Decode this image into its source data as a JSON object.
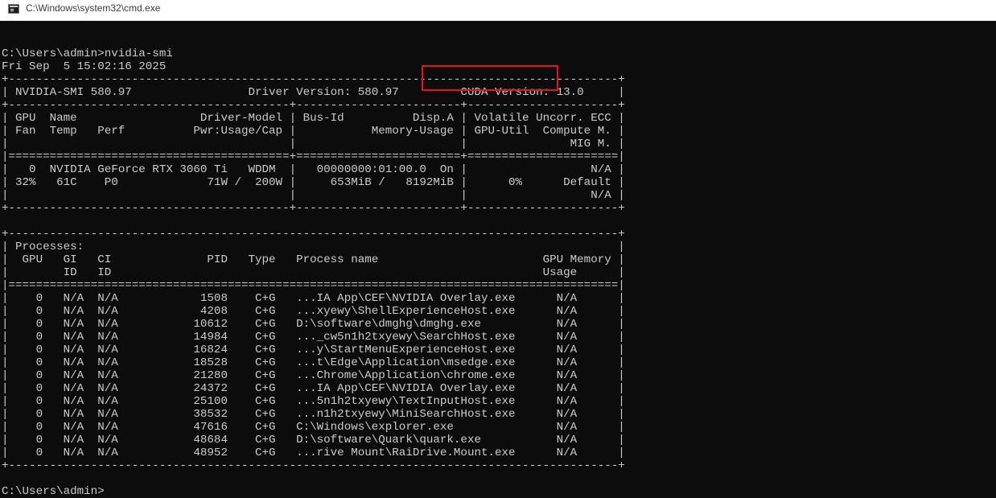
{
  "window": {
    "title": "C:\\Windows\\system32\\cmd.exe",
    "icon": "console-icon"
  },
  "console": {
    "lines": [
      "",
      "C:\\Users\\admin>nvidia-smi",
      "Fri Sep  5 15:02:16 2025",
      "+-----------------------------------------------------------------------------------------+",
      "| NVIDIA-SMI 580.97                 Driver Version: 580.97         CUDA Version: 13.0     |",
      "+-----------------------------------------+------------------------+----------------------+",
      "| GPU  Name                  Driver-Model | Bus-Id          Disp.A | Volatile Uncorr. ECC |",
      "| Fan  Temp   Perf          Pwr:Usage/Cap |           Memory-Usage | GPU-Util  Compute M. |",
      "|                                         |                        |               MIG M. |",
      "|=========================================+========================+======================|",
      "|   0  NVIDIA GeForce RTX 3060 Ti   WDDM  |   00000000:01:00.0  On |                  N/A |",
      "| 32%   61C    P0             71W /  200W |     653MiB /   8192MiB |      0%      Default |",
      "|                                         |                        |                  N/A |",
      "+-----------------------------------------+------------------------+----------------------+",
      "",
      "+-----------------------------------------------------------------------------------------+",
      "| Processes:                                                                              |",
      "|  GPU   GI   CI              PID   Type   Process name                        GPU Memory |",
      "|        ID   ID                                                               Usage      |",
      "|=========================================================================================|",
      "|    0   N/A  N/A            1508    C+G   ...IA App\\CEF\\NVIDIA Overlay.exe      N/A      |",
      "|    0   N/A  N/A            4208    C+G   ...xyewy\\ShellExperienceHost.exe      N/A      |",
      "|    0   N/A  N/A           10612    C+G   D:\\software\\dmghg\\dmghg.exe           N/A      |",
      "|    0   N/A  N/A           14984    C+G   ..._cw5n1h2txyewy\\SearchHost.exe      N/A      |",
      "|    0   N/A  N/A           16824    C+G   ...y\\StartMenuExperienceHost.exe      N/A      |",
      "|    0   N/A  N/A           18528    C+G   ...t\\Edge\\Application\\msedge.exe      N/A      |",
      "|    0   N/A  N/A           21280    C+G   ...Chrome\\Application\\chrome.exe      N/A      |",
      "|    0   N/A  N/A           24372    C+G   ...IA App\\CEF\\NVIDIA Overlay.exe      N/A      |",
      "|    0   N/A  N/A           25100    C+G   ...5n1h2txyewy\\TextInputHost.exe      N/A      |",
      "|    0   N/A  N/A           38532    C+G   ...n1h2txyewy\\MiniSearchHost.exe      N/A      |",
      "|    0   N/A  N/A           47616    C+G   C:\\Windows\\explorer.exe               N/A      |",
      "|    0   N/A  N/A           48684    C+G   D:\\software\\Quark\\quark.exe           N/A      |",
      "|    0   N/A  N/A           48952    C+G   ...rive Mount\\RaiDrive.Mount.exe      N/A      |",
      "+-----------------------------------------------------------------------------------------+",
      "",
      "C:\\Users\\admin>"
    ]
  },
  "colors": {
    "console_background": "#0c0c0c",
    "console_text": "#cccccc",
    "highlight_border": "#e81123"
  }
}
